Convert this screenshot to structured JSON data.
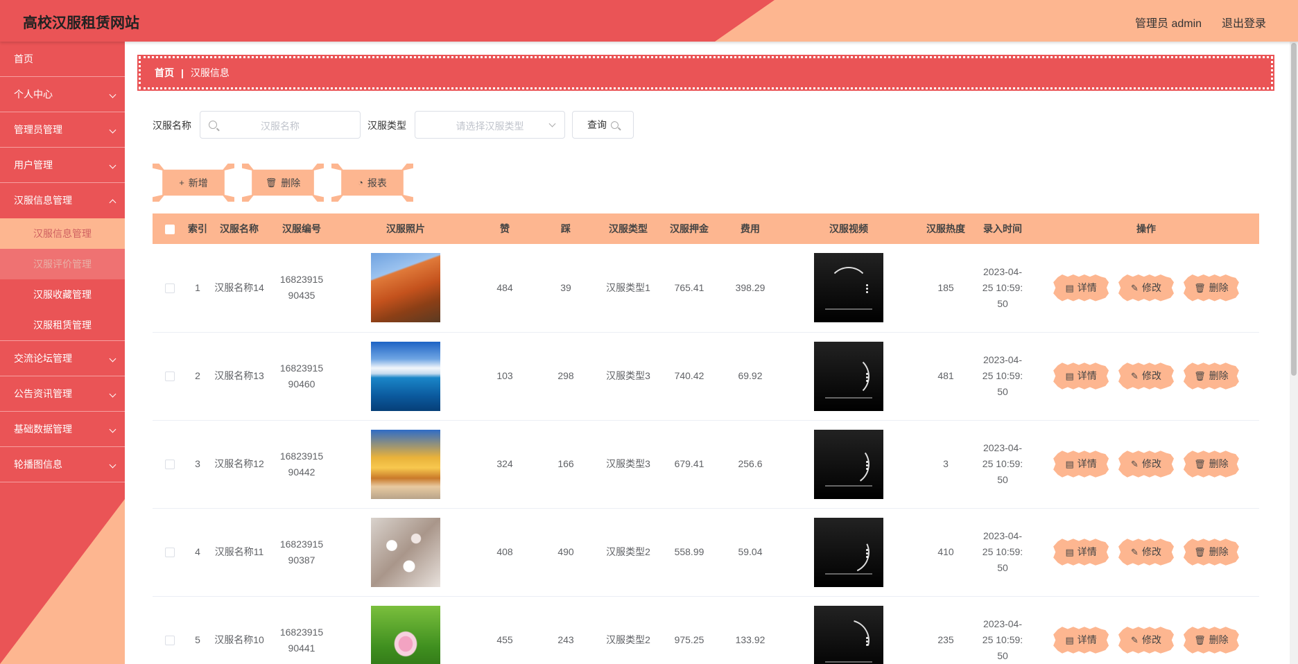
{
  "header": {
    "site_title": "高校汉服租赁网站",
    "admin_label": "管理员 admin",
    "logout": "退出登录"
  },
  "sidebar": {
    "items": [
      {
        "label": "首页",
        "has_children": false
      },
      {
        "label": "个人中心",
        "has_children": true
      },
      {
        "label": "管理员管理",
        "has_children": true
      },
      {
        "label": "用户管理",
        "has_children": true
      },
      {
        "label": "汉服信息管理",
        "has_children": true,
        "expanded": true
      },
      {
        "label": "交流论坛管理",
        "has_children": true
      },
      {
        "label": "公告资讯管理",
        "has_children": true
      },
      {
        "label": "基础数据管理",
        "has_children": true
      },
      {
        "label": "轮播图信息",
        "has_children": true
      }
    ],
    "subitems": [
      {
        "label": "汉服信息管理",
        "state": "active"
      },
      {
        "label": "汉服评价管理",
        "state": "hover"
      },
      {
        "label": "汉服收藏管理",
        "state": "normal"
      },
      {
        "label": "汉服租赁管理",
        "state": "normal"
      }
    ]
  },
  "breadcrumb": {
    "home": "首页",
    "separator": "|",
    "current": "汉服信息"
  },
  "search": {
    "name_label": "汉服名称",
    "name_placeholder": "汉服名称",
    "type_label": "汉服类型",
    "type_placeholder": "请选择汉服类型",
    "query_label": "查询"
  },
  "actions": {
    "add": "新增",
    "delete": "删除",
    "report": "报表"
  },
  "table": {
    "headers": [
      "索引",
      "汉服名称",
      "汉服编号",
      "汉服照片",
      "赞",
      "踩",
      "汉服类型",
      "汉服押金",
      "费用",
      "汉服视频",
      "汉服热度",
      "录入时间",
      "操作"
    ],
    "op_labels": {
      "detail": "详情",
      "edit": "修改",
      "delete": "删除"
    },
    "rows": [
      {
        "index": "1",
        "name": "汉服名称14",
        "code_a": "16823915",
        "code_b": "90435",
        "photo": "mountain",
        "likes": "484",
        "dislikes": "39",
        "type": "汉服类型1",
        "deposit": "765.41",
        "fee": "398.29",
        "heat": "185",
        "time_a": "2023-04-",
        "time_b": "25 10:59:",
        "time_c": "50"
      },
      {
        "index": "2",
        "name": "汉服名称13",
        "code_a": "16823915",
        "code_b": "90460",
        "photo": "sea",
        "likes": "103",
        "dislikes": "298",
        "type": "汉服类型3",
        "deposit": "740.42",
        "fee": "69.92",
        "heat": "481",
        "time_a": "2023-04-",
        "time_b": "25 10:59:",
        "time_c": "50"
      },
      {
        "index": "3",
        "name": "汉服名称12",
        "code_a": "16823915",
        "code_b": "90442",
        "photo": "sunset",
        "likes": "324",
        "dislikes": "166",
        "type": "汉服类型3",
        "deposit": "679.41",
        "fee": "256.6",
        "heat": "3",
        "time_a": "2023-04-",
        "time_b": "25 10:59:",
        "time_c": "50"
      },
      {
        "index": "4",
        "name": "汉服名称11",
        "code_a": "16823915",
        "code_b": "90387",
        "photo": "blossom",
        "likes": "408",
        "dislikes": "490",
        "type": "汉服类型2",
        "deposit": "558.99",
        "fee": "59.04",
        "heat": "410",
        "time_a": "2023-04-",
        "time_b": "25 10:59:",
        "time_c": "50"
      },
      {
        "index": "5",
        "name": "汉服名称10",
        "code_a": "16823915",
        "code_b": "90441",
        "photo": "lotus",
        "likes": "455",
        "dislikes": "243",
        "type": "汉服类型2",
        "deposit": "975.25",
        "fee": "133.92",
        "heat": "235",
        "time_a": "2023-04-",
        "time_b": "25 10:59:",
        "time_c": "50"
      }
    ]
  },
  "colors": {
    "primary": "#ea5456",
    "accent": "#fdb690"
  }
}
